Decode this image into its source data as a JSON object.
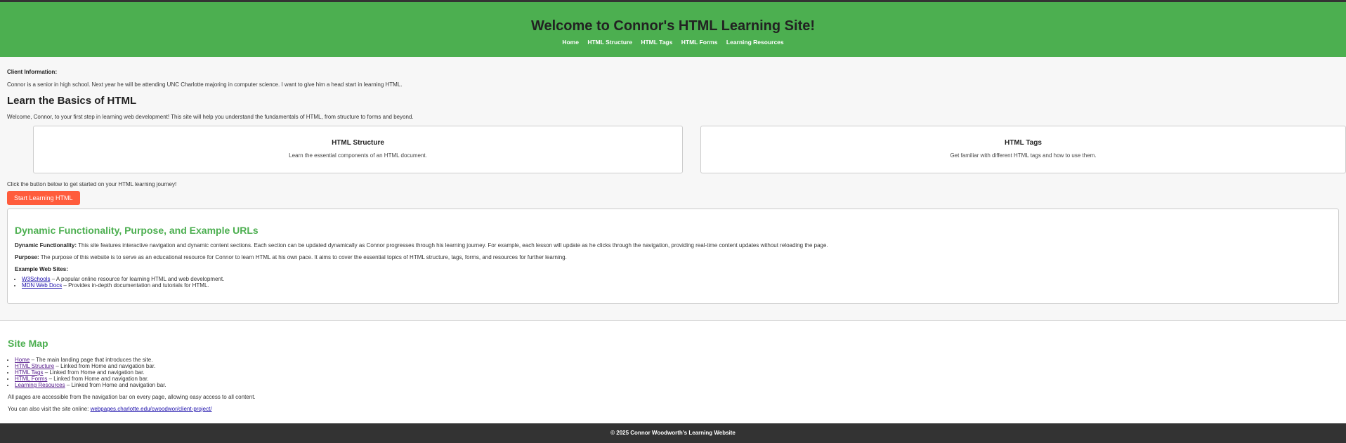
{
  "header": {
    "title": "Welcome to Connor's HTML Learning Site!",
    "nav": [
      "Home",
      "HTML Structure",
      "HTML Tags",
      "HTML Forms",
      "Learning Resources"
    ]
  },
  "client": {
    "label": "Client Information:",
    "text": "Connor is a senior in high school. Next year he will be attending UNC Charlotte majoring in computer science. I want to give him a head start in learning HTML."
  },
  "basics": {
    "title": "Learn the Basics of HTML",
    "intro": "Welcome, Connor, to your first step in learning web development! This site will help you understand the fundamentals of HTML, from structure to forms and beyond.",
    "cards": [
      {
        "title": "HTML Structure",
        "text": "Learn the essential components of an HTML document."
      },
      {
        "title": "HTML Tags",
        "text": "Get familiar with different HTML tags and how to use them."
      }
    ],
    "cta_text": "Click the button below to get started on your HTML learning journey!",
    "button": "Start Learning HTML"
  },
  "dynamic": {
    "title": "Dynamic Functionality, Purpose, and Example URLs",
    "func_label": "Dynamic Functionality:",
    "func_text": " This site features interactive navigation and dynamic content sections. Each section can be updated dynamically as Connor progresses through his learning journey. For example, each lesson will update as he clicks through the navigation, providing real-time content updates without reloading the page.",
    "purpose_label": "Purpose:",
    "purpose_text": " The purpose of this website is to serve as an educational resource for Connor to learn HTML at his own pace. It aims to cover the essential topics of HTML structure, tags, forms, and resources for further learning.",
    "examples_label": "Example Web Sites:",
    "examples": [
      {
        "link": "W3Schools",
        "desc": " – A popular online resource for learning HTML and web development."
      },
      {
        "link": "MDN Web Docs",
        "desc": " – Provides in-depth documentation and tutorials for HTML."
      }
    ]
  },
  "sitemap": {
    "title": "Site Map",
    "items": [
      {
        "link": "Home",
        "desc": " – The main landing page that introduces the site."
      },
      {
        "link": "HTML Structure",
        "desc": " – Linked from Home and navigation bar."
      },
      {
        "link": "HTML Tags",
        "desc": " – Linked from Home and navigation bar."
      },
      {
        "link": "HTML Forms",
        "desc": " – Linked from Home and navigation bar."
      },
      {
        "link": "Learning Resources",
        "desc": " – Linked from Home and navigation bar."
      }
    ],
    "note": "All pages are accessible from the navigation bar on every page, allowing easy access to all content.",
    "visit_text": "You can also visit the site online: ",
    "visit_link": "webpages.charlotte.edu/cwoodwor/client-project/"
  },
  "footer": {
    "text": "© 2025 Connor Woodworth's Learning Website"
  },
  "colors": {
    "header_green": "#4caf50",
    "button": "#ff5c3c",
    "footer": "#333333"
  }
}
